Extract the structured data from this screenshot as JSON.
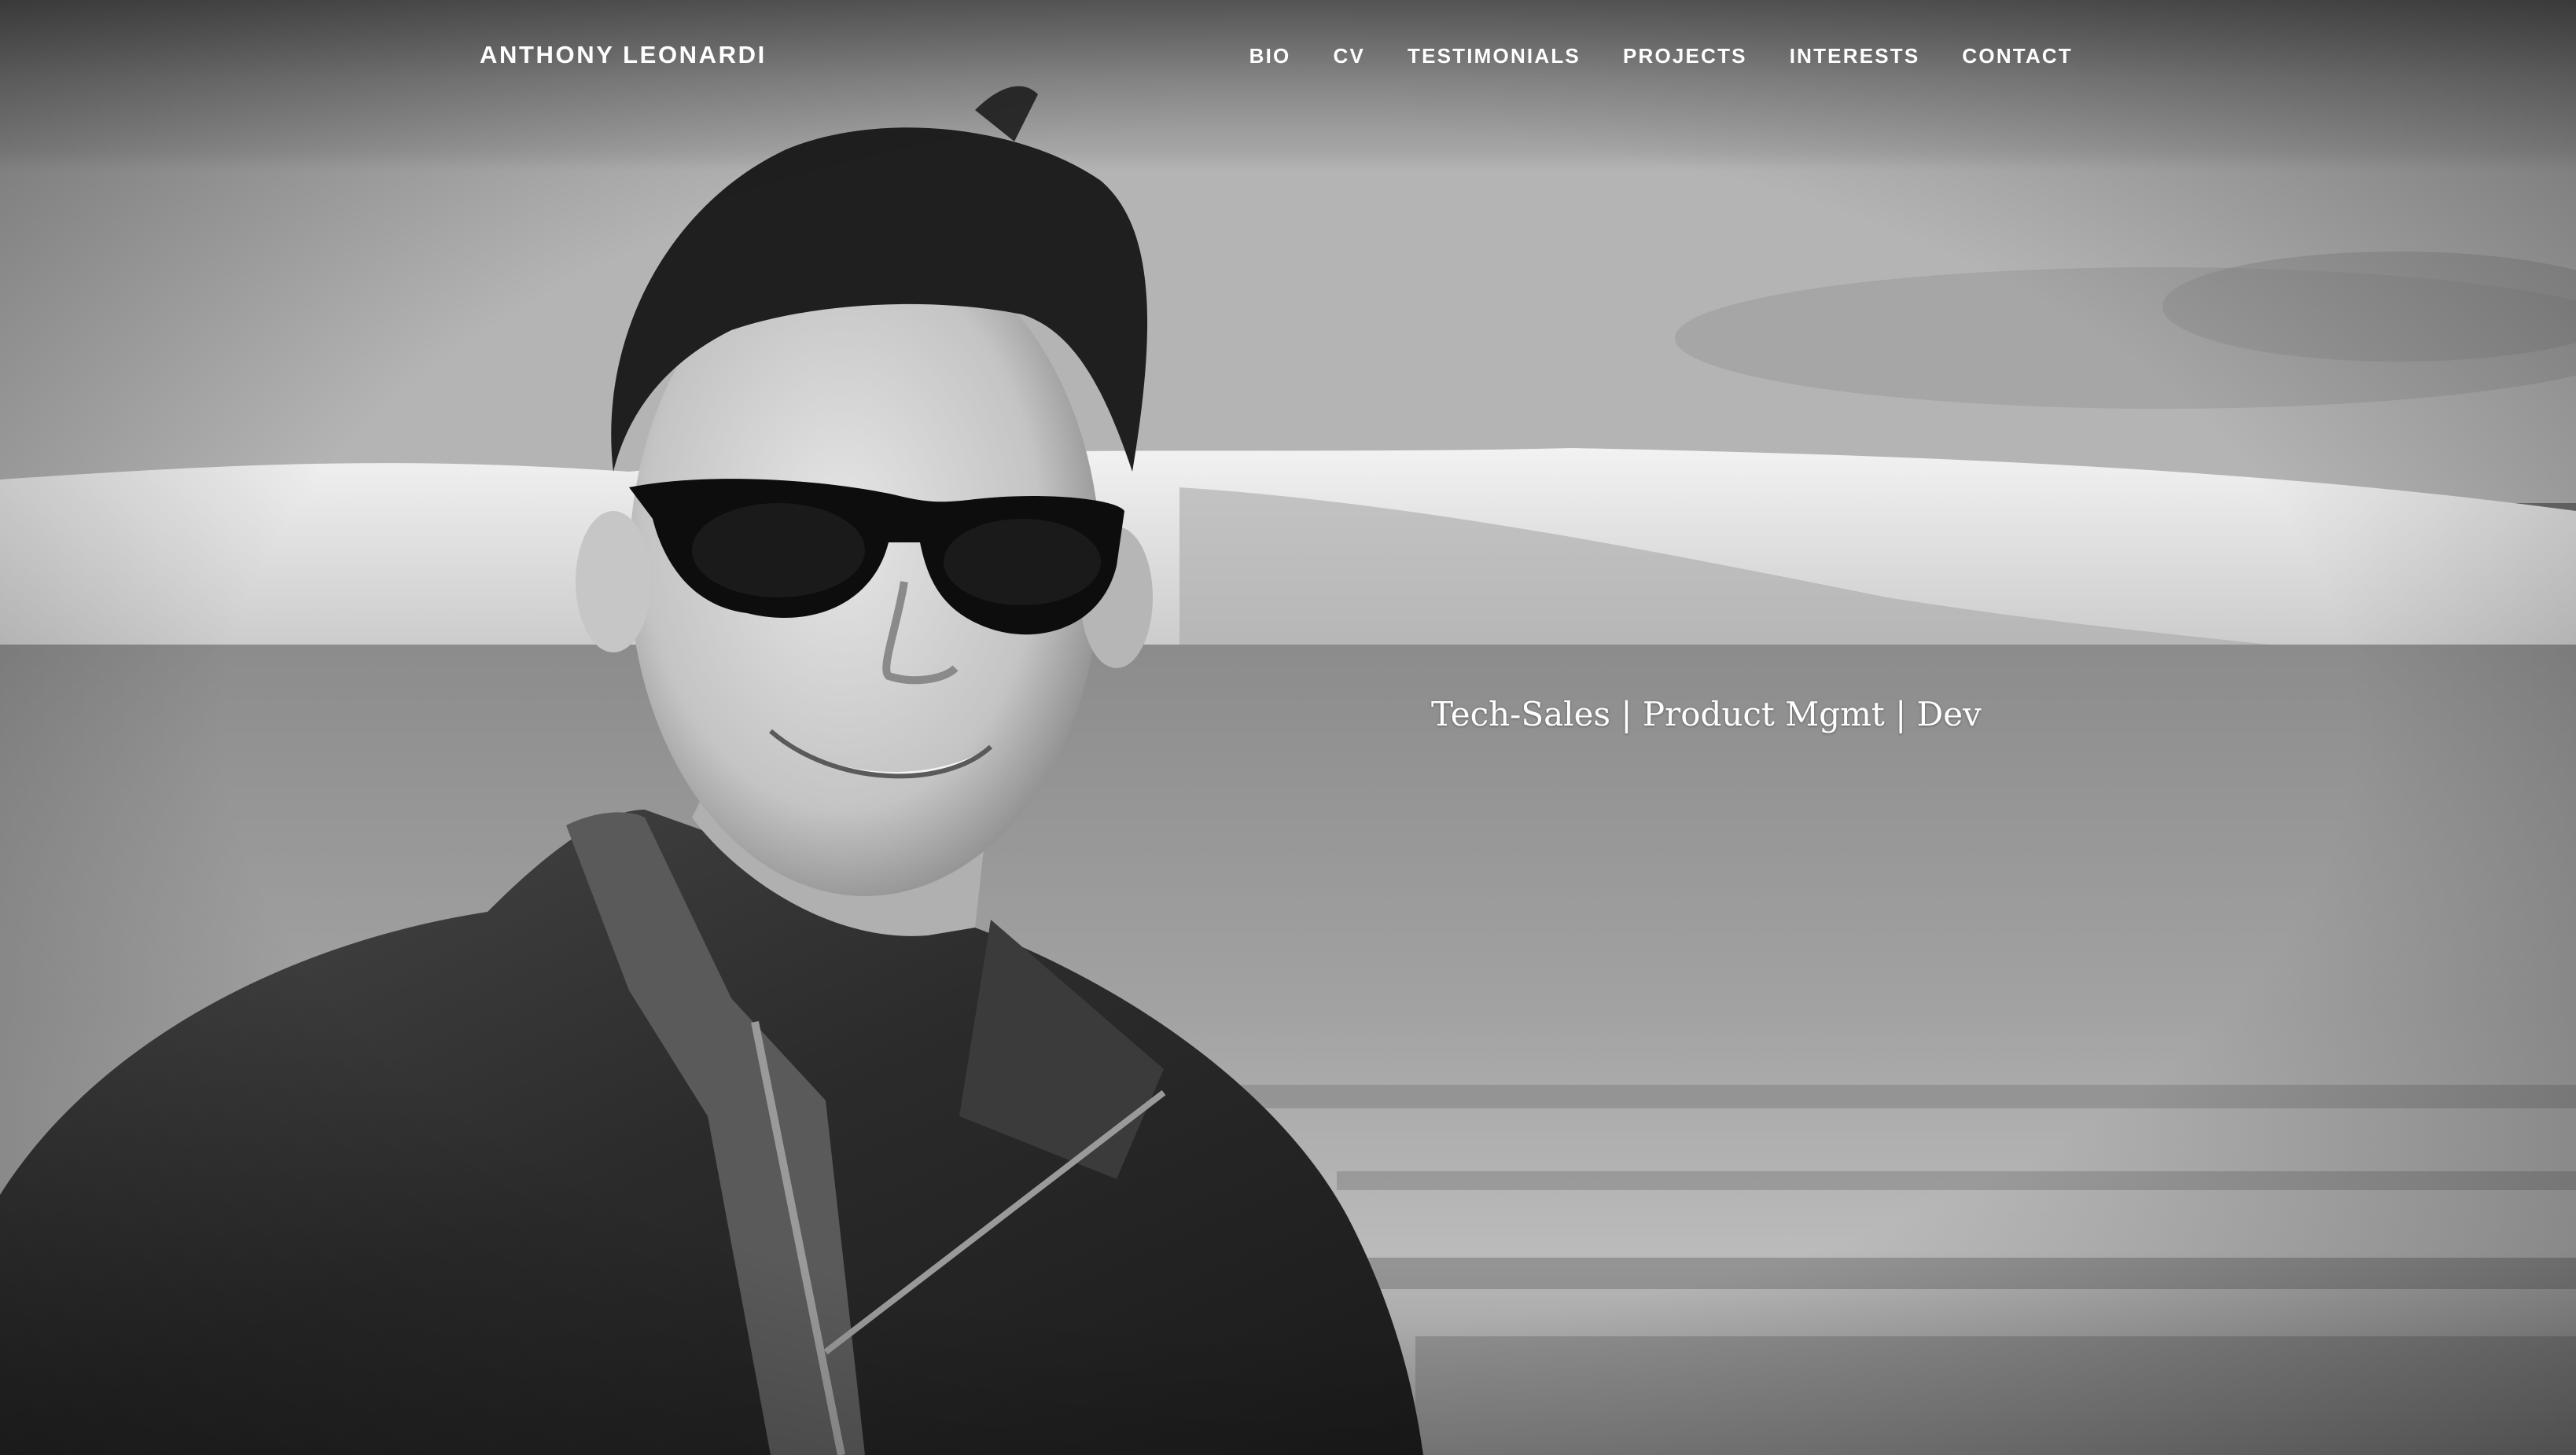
{
  "site": {
    "title": "ANTHONY LEONARDI"
  },
  "nav": {
    "items": [
      {
        "label": "BIO"
      },
      {
        "label": "CV"
      },
      {
        "label": "TESTIMONIALS"
      },
      {
        "label": "PROJECTS"
      },
      {
        "label": "INTERESTS"
      },
      {
        "label": "CONTACT"
      }
    ]
  },
  "hero": {
    "tagline": "Tech-Sales | Product Mgmt | Dev",
    "image": "black-and-white portrait photo",
    "colors": {
      "text": "#ffffff"
    }
  }
}
